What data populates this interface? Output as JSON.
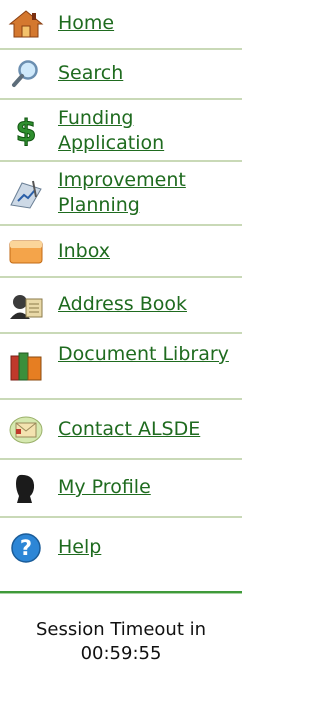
{
  "nav": {
    "items": [
      {
        "label": "Home",
        "icon": "home-icon"
      },
      {
        "label": "Search",
        "icon": "magnifier-icon"
      },
      {
        "label": "Funding Application",
        "icon": "dollar-sign-icon"
      },
      {
        "label": "Improvement Planning",
        "icon": "planning-chart-icon"
      },
      {
        "label": "Inbox",
        "icon": "inbox-tray-icon"
      },
      {
        "label": "Address Book",
        "icon": "address-book-icon"
      },
      {
        "label": "Document Library",
        "icon": "books-icon"
      },
      {
        "label": "Contact ALSDE",
        "icon": "envelope-icon"
      },
      {
        "label": "My Profile",
        "icon": "profile-silhouette-icon"
      },
      {
        "label": "Help",
        "icon": "help-question-icon"
      }
    ]
  },
  "session": {
    "label": "Session Timeout in",
    "time": "00:59:55"
  },
  "colors": {
    "link": "#1f6b1f",
    "divider": "#c9d9b7",
    "footer_rule": "#3f9a3a"
  }
}
